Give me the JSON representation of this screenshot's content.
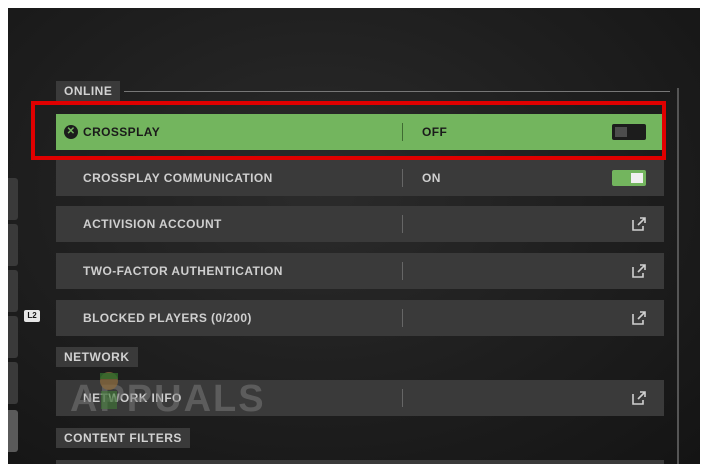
{
  "sections": {
    "online": "ONLINE",
    "network": "NETWORK",
    "content_filters": "CONTENT FILTERS"
  },
  "rows": {
    "crossplay": {
      "label": "CROSSPLAY",
      "value": "OFF"
    },
    "crossplay_comm": {
      "label": "CROSSPLAY COMMUNICATION",
      "value": "ON"
    },
    "activision": {
      "label": "ACTIVISION ACCOUNT"
    },
    "two_factor": {
      "label": "TWO-FACTOR AUTHENTICATION"
    },
    "blocked": {
      "label": "BLOCKED PLAYERS (0/200)"
    },
    "network_info": {
      "label": "NETWORK INFO"
    }
  },
  "badge": "L2",
  "watermark": "APPUALS",
  "colors": {
    "highlight": "#73b55e",
    "row_bg": "#3a3a3a",
    "annotation_border": "#e00000"
  },
  "icons": {
    "crossplay": "x-circle-icon",
    "external": "external-link-icon"
  }
}
